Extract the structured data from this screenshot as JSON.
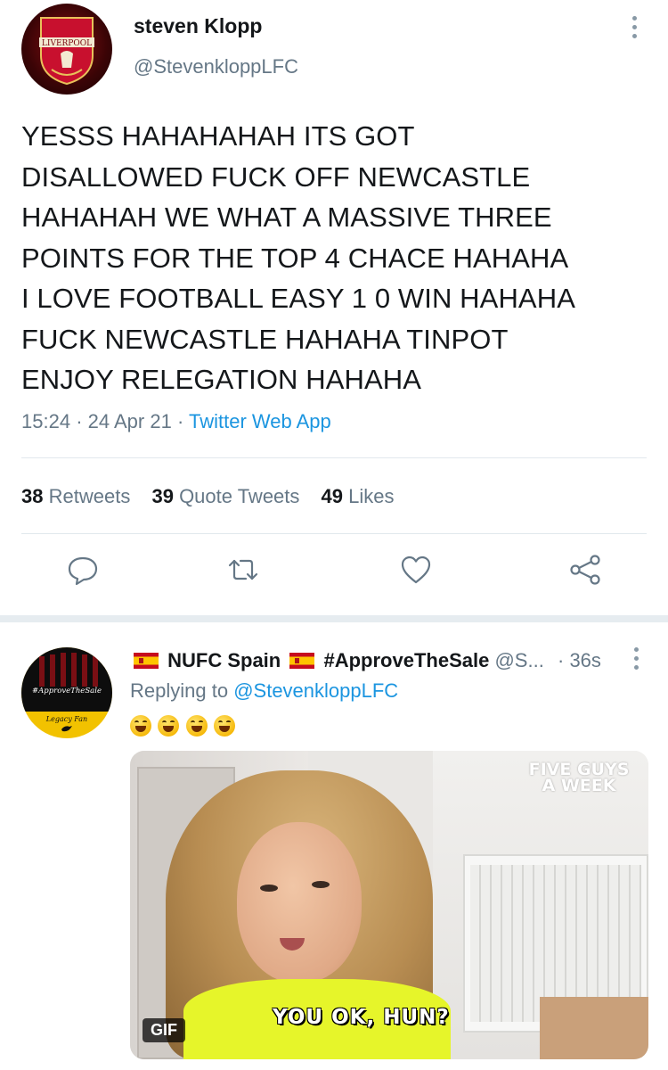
{
  "tweet": {
    "author_name": "steven Klopp",
    "author_handle": "@StevenkloppLFC",
    "avatar_crest_text": "LIVERPOOL",
    "text_lines": [
      "YESSS HAHAHAHAH ITS GOT",
      "DISALLOWED FUCK OFF NEWCASTLE",
      "HAHAHAH WE WHAT A MASSIVE THREE",
      "POINTS FOR THE TOP 4 CHACE HAHAHA",
      "I LOVE FOOTBALL EASY 1 0 WIN HAHAHA",
      "FUCK NEWCASTLE HAHAHA TINPOT",
      "ENJOY RELEGATION HAHAHA"
    ],
    "time": "15:24",
    "date": "24 Apr 21",
    "separator": "·",
    "source": "Twitter Web App",
    "stats": {
      "retweets_count": "38",
      "retweets_label": "Retweets",
      "quotes_count": "39",
      "quotes_label": "Quote Tweets",
      "likes_count": "49",
      "likes_label": "Likes"
    },
    "actions": [
      "reply-icon",
      "retweet-icon",
      "like-icon",
      "share-icon"
    ]
  },
  "reply": {
    "display_name": "NUFC Spain",
    "hashtag": "#ApproveTheSale",
    "handle_truncated": "@S...",
    "time": "· 36s",
    "replying_prefix": "Replying to",
    "replying_to": "@StevenkloppLFC",
    "emojis": [
      "grinning-squinting-face",
      "grinning-squinting-face",
      "grinning-squinting-face",
      "grinning-squinting-face"
    ],
    "avatar_tagline": "#ApproveTheSale",
    "avatar_subtitle": "Legacy Fan",
    "gif": {
      "badge": "GIF",
      "brand_line1": "FIVE GUYS",
      "brand_line2": "A WEEK",
      "caption": "YOU OK, HUN?"
    }
  },
  "colors": {
    "text": "#14171a",
    "secondary": "#657786",
    "link": "#1b95e0",
    "divider": "#e1e8ed"
  }
}
